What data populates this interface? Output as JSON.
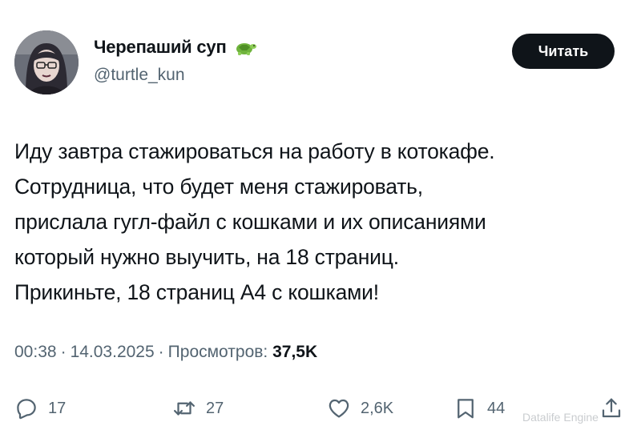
{
  "author": {
    "display_name": "Черепаший суп",
    "handle": "@turtle_kun",
    "badge_icon": "turtle-icon"
  },
  "read_button": {
    "label": "Читать"
  },
  "tweet": {
    "lines": [
      "Иду завтра стажироваться на работу в котокафе.",
      "Сотрудница, что будет меня стажировать,",
      "прислала гугл-файл с кошками и их описаниями",
      "который нужно выучить, на 18 страниц.",
      "Прикиньте, 18 страниц А4 с кошками!"
    ]
  },
  "meta": {
    "time": "00:38",
    "separator": "·",
    "date": "14.03.2025",
    "views_label": "Просмотров:",
    "views_count": "37,5K"
  },
  "actions": {
    "replies": {
      "icon": "reply-icon",
      "count": "17"
    },
    "retweets": {
      "icon": "retweet-icon",
      "count": "27"
    },
    "likes": {
      "icon": "heart-icon",
      "count": "2,6K"
    },
    "bookmarks": {
      "icon": "bookmark-icon",
      "count": "44"
    },
    "share": {
      "icon": "share-icon"
    }
  },
  "watermark": "Datalife Engine",
  "colors": {
    "text": "#0f1419",
    "secondary": "#536471",
    "button_bg": "#0f1419",
    "button_text": "#ffffff",
    "turtle_green": "#6fb33c"
  }
}
